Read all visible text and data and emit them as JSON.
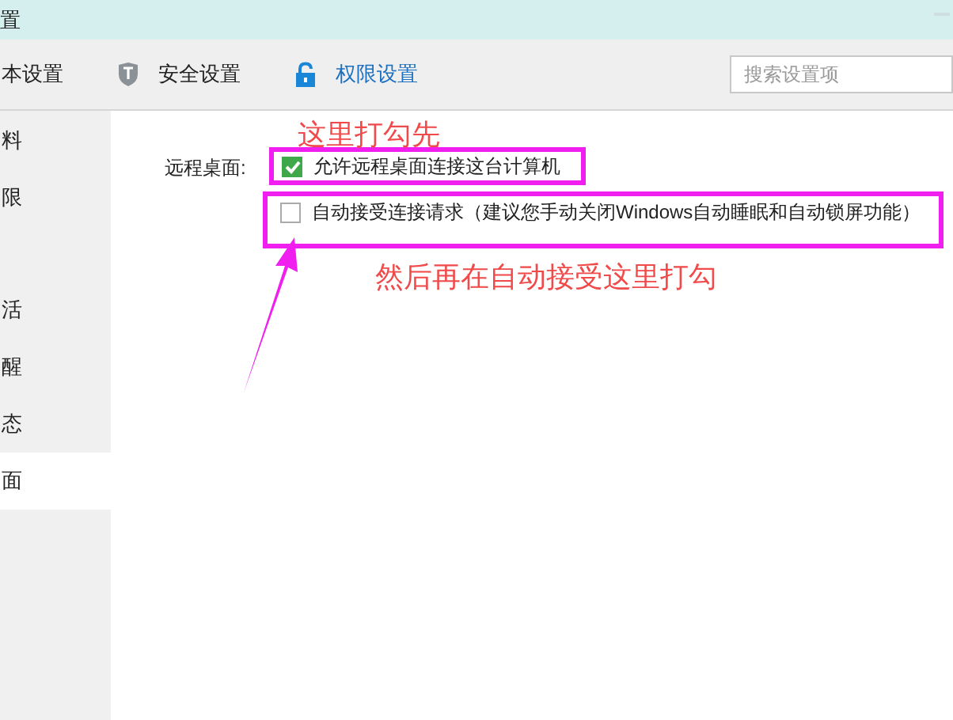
{
  "window": {
    "title": "置"
  },
  "tabs": [
    {
      "label": "本设置",
      "kind": "plain",
      "selected": false
    },
    {
      "label": "安全设置",
      "kind": "shield",
      "selected": false
    },
    {
      "label": "权限设置",
      "kind": "lock",
      "selected": true
    }
  ],
  "search": {
    "placeholder": "搜索设置项"
  },
  "sidebar": {
    "items": [
      {
        "label": "料",
        "selected": false
      },
      {
        "label": "限",
        "selected": false
      },
      {
        "label": "活",
        "selected": false
      },
      {
        "label": "醒",
        "selected": false
      },
      {
        "label": "态",
        "selected": false
      },
      {
        "label": "面",
        "selected": true
      }
    ]
  },
  "remote_desktop": {
    "label": "远程桌面:",
    "options": [
      {
        "label": "允许远程桌面连接这台计算机",
        "checked": true
      },
      {
        "label": "自动接受连接请求（建议您手动关闭Windows自动睡眠和自动锁屏功能）",
        "checked": false
      }
    ]
  },
  "annotations": [
    {
      "text": "这里打勾先"
    },
    {
      "text": "然后再在自动接受这里打勾"
    }
  ]
}
